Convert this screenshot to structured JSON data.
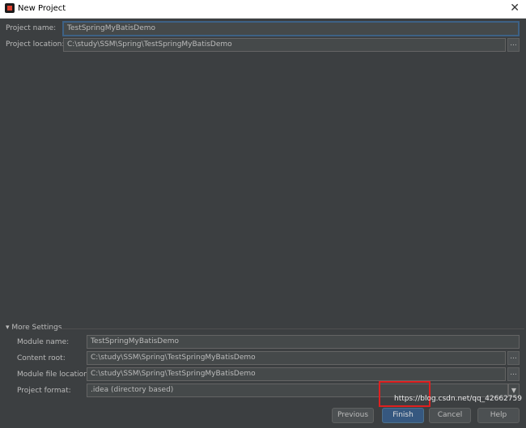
{
  "window": {
    "title": "New Project",
    "close_glyph": "✕"
  },
  "project": {
    "name_label": "Project name:",
    "name_value": "TestSpringMyBatisDemo",
    "location_label": "Project location:",
    "location_value": "C:\\study\\SSM\\Spring\\TestSpringMyBatisDemo",
    "browse_glyph": "..."
  },
  "more_settings": {
    "toggle_label": "▾ More Settings",
    "module_name_label": "Module name:",
    "module_name_value": "TestSpringMyBatisDemo",
    "content_root_label": "Content root:",
    "content_root_value": "C:\\study\\SSM\\Spring\\TestSpringMyBatisDemo",
    "module_file_label": "Module file location:",
    "module_file_value": "C:\\study\\SSM\\Spring\\TestSpringMyBatisDemo",
    "format_label": "Project format:",
    "format_value": ".idea (directory based)",
    "dropdown_glyph": "▼"
  },
  "buttons": {
    "previous": "Previous",
    "finish": "Finish",
    "cancel": "Cancel",
    "help": "Help"
  },
  "watermark": "https://blog.csdn.net/qq_42662759"
}
